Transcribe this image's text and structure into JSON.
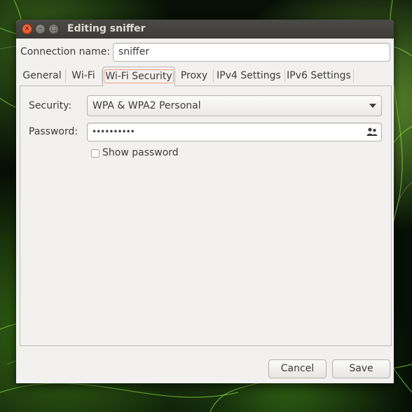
{
  "window": {
    "title": "Editing sniffer"
  },
  "connection": {
    "label": "Connection name:",
    "value": "sniffer"
  },
  "tabs": [
    {
      "label": "General"
    },
    {
      "label": "Wi-Fi"
    },
    {
      "label": "Wi-Fi Security",
      "active": true
    },
    {
      "label": "Proxy"
    },
    {
      "label": "IPv4 Settings"
    },
    {
      "label": "IPv6 Settings"
    }
  ],
  "security": {
    "label": "Security:",
    "selected": "WPA & WPA2 Personal"
  },
  "password": {
    "label": "Password:",
    "value": "••••••••••"
  },
  "show_password": {
    "label": "Show password",
    "checked": false
  },
  "buttons": {
    "cancel": "Cancel",
    "save": "Save"
  },
  "icons": {
    "close": "close-icon",
    "minimize": "minimize-icon",
    "maximize": "maximize-icon",
    "password_users": "users-icon"
  },
  "colors": {
    "titlebar": "#3c3b37",
    "close_button": "#e2571f",
    "window_bg": "#f2f1f0",
    "active_tab_outline": "#f0a080"
  }
}
